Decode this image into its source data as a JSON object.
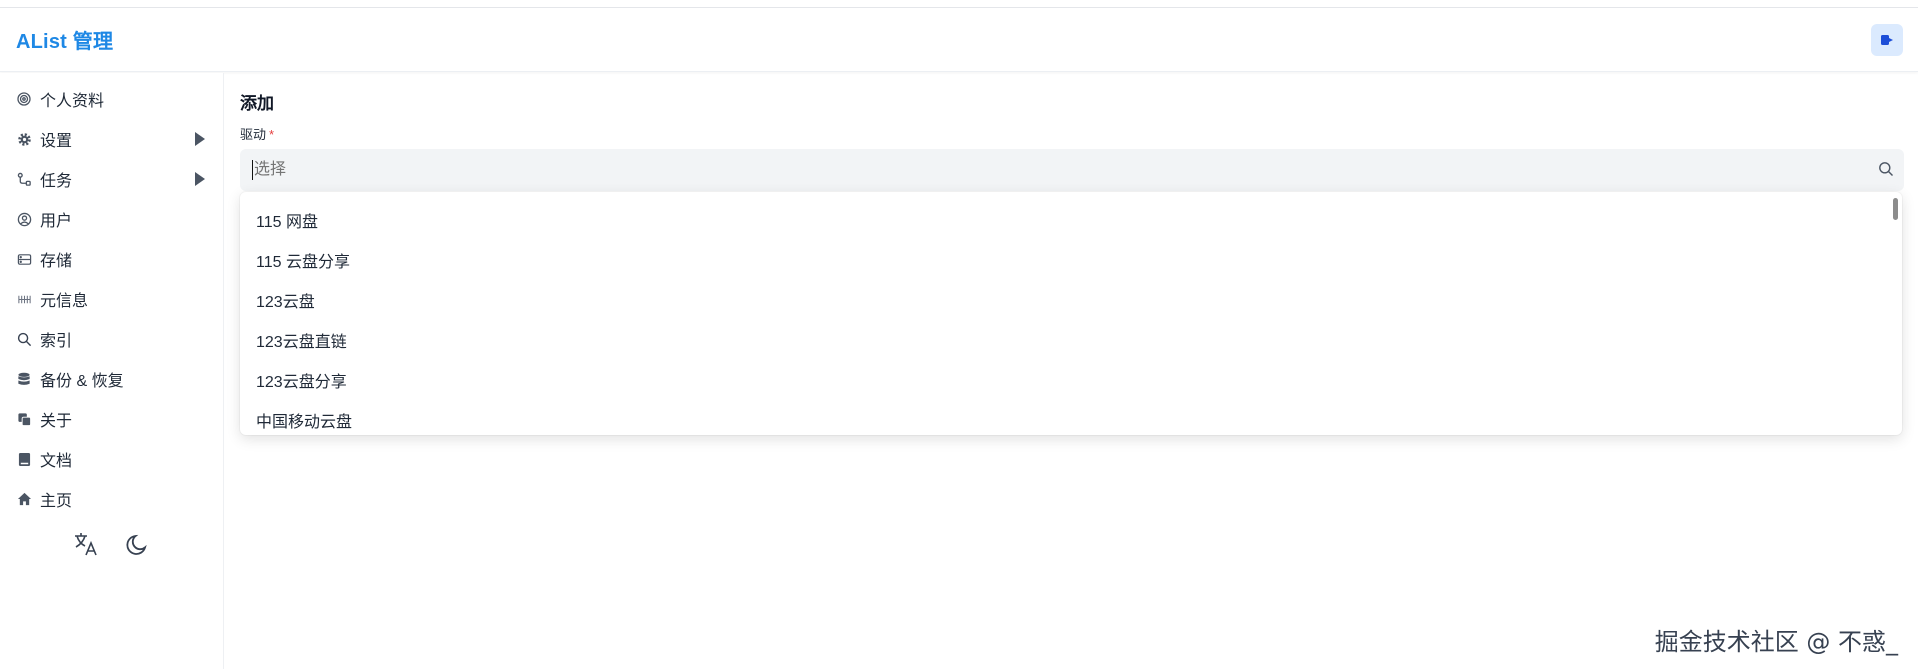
{
  "header": {
    "brand": "AList 管理"
  },
  "sidebar": {
    "items": [
      {
        "label": "个人资料",
        "icon": "fingerprint-icon"
      },
      {
        "label": "设置",
        "icon": "gear-icon",
        "expandable": true
      },
      {
        "label": "任务",
        "icon": "task-flow-icon",
        "expandable": true
      },
      {
        "label": "用户",
        "icon": "user-circle-icon"
      },
      {
        "label": "存储",
        "icon": "storage-icon"
      },
      {
        "label": "元信息",
        "icon": "meta-icon"
      },
      {
        "label": "索引",
        "icon": "search-icon"
      },
      {
        "label": "备份 & 恢复",
        "icon": "database-icon"
      },
      {
        "label": "关于",
        "icon": "copy-icon"
      },
      {
        "label": "文档",
        "icon": "book-icon"
      },
      {
        "label": "主页",
        "icon": "home-icon"
      }
    ]
  },
  "main": {
    "title": "添加",
    "driver_field": {
      "label": "驱动",
      "required_mark": "*",
      "placeholder": "选择",
      "options": [
        "115 网盘",
        "115 云盘分享",
        "123云盘",
        "123云盘直链",
        "123云盘分享",
        "中国移动云盘"
      ]
    }
  },
  "watermark": "掘金技术社区 @ 不惑_",
  "colors": {
    "brand": "#1e88e5",
    "required": "#e53e3e",
    "input_bg": "#f2f4f6"
  }
}
